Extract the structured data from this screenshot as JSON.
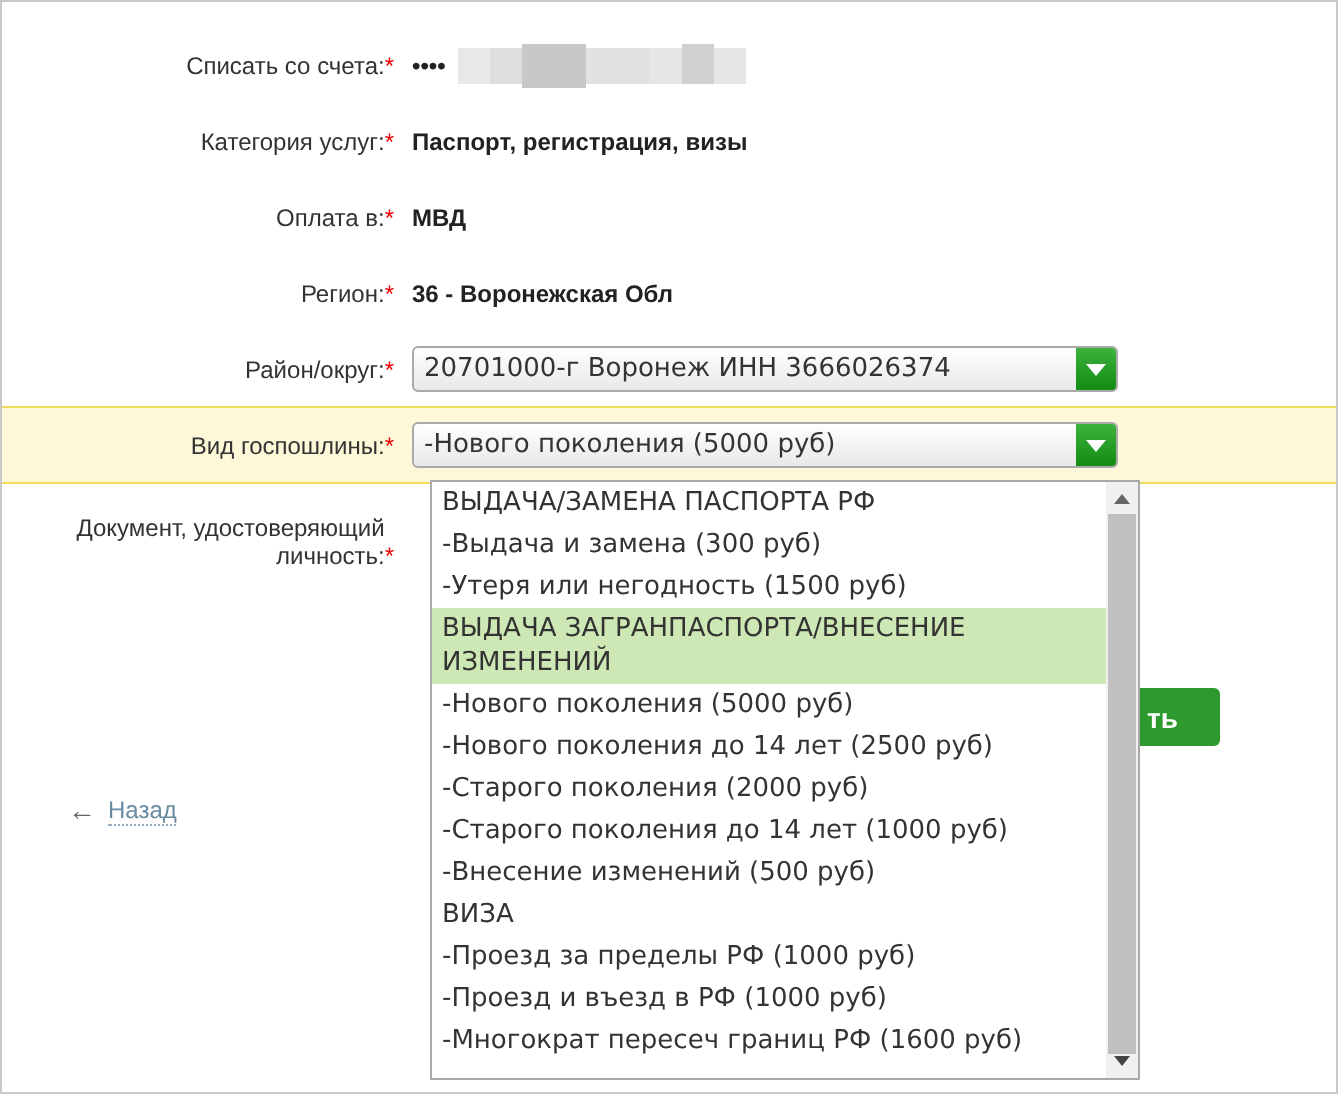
{
  "form": {
    "rows": [
      {
        "label": "Списать со счета:",
        "required": "*",
        "kind": "masked",
        "value": "••••"
      },
      {
        "label": "Категория услуг:",
        "required": "*",
        "kind": "text",
        "value": "Паспорт, регистрация, визы"
      },
      {
        "label": "Оплата в:",
        "required": "*",
        "kind": "text",
        "value": "МВД"
      },
      {
        "label": "Регион:",
        "required": "*",
        "kind": "text",
        "value": "36 - Воронежская Обл"
      },
      {
        "label": "Район/округ:",
        "required": "*",
        "kind": "select",
        "value": "20701000-г Воронеж ИНН 3666026374",
        "highlighted": false
      },
      {
        "label": "Вид госпошлины:",
        "required": "*",
        "kind": "select",
        "value": "-Нового поколения (5000 руб)",
        "highlighted": true
      },
      {
        "label": "Документ, удостоверяющий личность:",
        "required": "*",
        "kind": "empty"
      }
    ]
  },
  "dropdown": {
    "items": [
      {
        "label": "ВЫДАЧА/ЗАМЕНА ПАСПОРТА РФ",
        "selected": false
      },
      {
        "label": "-Выдача и замена (300 руб)",
        "selected": false
      },
      {
        "label": "-Утеря или негодность (1500 руб)",
        "selected": false
      },
      {
        "label": "ВЫДАЧА ЗАГРАНПАСПОРТА/ВНЕСЕНИЕ ИЗМЕНЕНИЙ",
        "selected": true
      },
      {
        "label": "-Нового поколения (5000 руб)",
        "selected": false
      },
      {
        "label": "-Нового поколения до 14 лет (2500 руб)",
        "selected": false
      },
      {
        "label": "-Старого поколения (2000 руб)",
        "selected": false
      },
      {
        "label": "-Старого поколения до 14 лет (1000 руб)",
        "selected": false
      },
      {
        "label": "-Внесение изменений (500 руб)",
        "selected": false
      },
      {
        "label": "ВИЗА",
        "selected": false
      },
      {
        "label": "-Проезд за пределы РФ (1000 руб)",
        "selected": false
      },
      {
        "label": "-Проезд и въезд в РФ (1000 руб)",
        "selected": false
      },
      {
        "label": "-Многократ пересеч границ РФ (1600 руб)",
        "selected": false
      }
    ]
  },
  "submit_button": "ть",
  "back_link": {
    "arrow": "←",
    "label": "Назад"
  }
}
